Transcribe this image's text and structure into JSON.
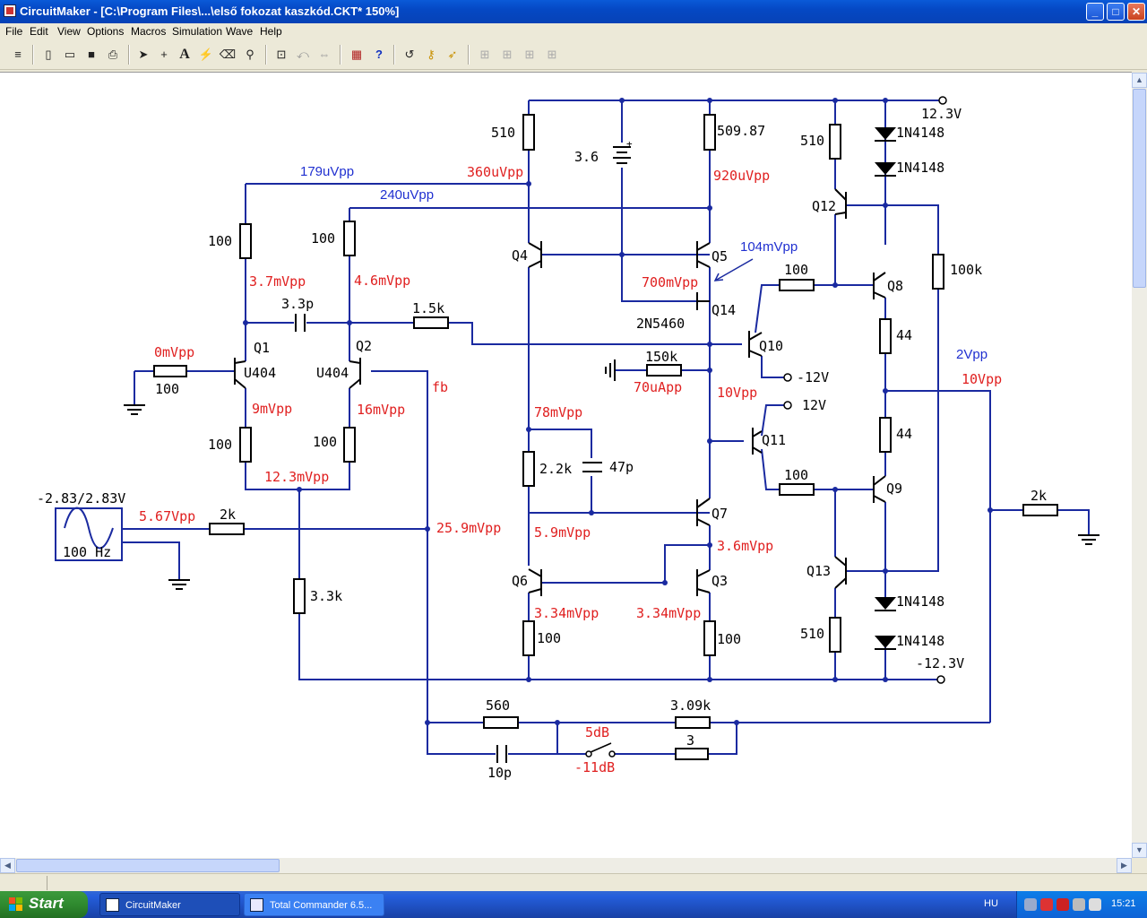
{
  "window": {
    "title": "CircuitMaker - [C:\\Program Files\\...\\első fokozat kaszkód.CKT* 150%]"
  },
  "window_buttons": {
    "minimize": "_",
    "maximize": "□",
    "close": "✕"
  },
  "menu": [
    "File",
    "Edit",
    "View",
    "Options",
    "Macros",
    "Simulation",
    "Wave",
    "Help"
  ],
  "toolbar": {
    "icons": [
      "options-icon",
      "new-icon",
      "open-icon",
      "save-icon",
      "print-icon",
      "arrow-tool-icon",
      "wire-tool-icon",
      "text-tool-icon",
      "probe-tool-icon",
      "delete-tool-icon",
      "zoom-tool-icon",
      "zoom-fit-icon",
      "rotate-icon",
      "mirror-icon",
      "netlist-icon",
      "help-icon",
      "reset-icon",
      "step-icon",
      "run-icon",
      "grid1-icon",
      "grid2-icon",
      "grid3-icon",
      "grid4-icon"
    ],
    "glyphs": {
      "arrow": "➤",
      "wire": "+",
      "text": "A",
      "probe": "⚡",
      "zoom": "🔍",
      "help": "?"
    }
  },
  "schematic": {
    "labels_black": {
      "r510a": "510",
      "c36": "3.6",
      "r50987": "509.87",
      "r510b": "510",
      "d1": "1N4148",
      "d2": "1N4148",
      "v123": "12.3V",
      "q12": "Q12",
      "r100k": "100k",
      "q8": "Q8",
      "r100a": "100",
      "r100b": "100",
      "r100c": "100",
      "q4": "Q4",
      "q5": "Q5",
      "c33p": "3.3p",
      "r15k": "1.5k",
      "q14": "Q14",
      "q14type": "2N5460",
      "q10": "Q10",
      "r44a": "44",
      "q1": "Q1",
      "q2": "Q2",
      "u404a": "U404",
      "u404b": "U404",
      "r100d": "100",
      "r150k": "150k",
      "vm12": "-12V",
      "r22k": "2.2k",
      "c47p": "47p",
      "v12": "12V",
      "q11": "Q11",
      "r44b": "44",
      "r100e": "100",
      "r100f": "100",
      "q9": "Q9",
      "src_range": "-2.83/2.83V",
      "src_freq": "100 Hz",
      "r2k": "2k",
      "r2k_out": "2k",
      "q7": "Q7",
      "r33k": "3.3k",
      "q6": "Q6",
      "q3": "Q3",
      "q13": "Q13",
      "d3": "1N4148",
      "d4": "1N4148",
      "r100g": "100",
      "r100h": "100",
      "r510c": "510",
      "vm123": "-12.3V",
      "r560": "560",
      "r309k": "3.09k",
      "r3": "3",
      "c10p": "10p"
    },
    "labels_blue": {
      "p179": "179uVpp",
      "p240": "240uVpp",
      "p104": "104mVpp",
      "p2": "2Vpp"
    },
    "labels_red": {
      "p360": "360uVpp",
      "p920": "920uVpp",
      "p37": "3.7mVpp",
      "p46": "4.6mVpp",
      "p700": "700mVpp",
      "p0": "0mVpp",
      "p9": "9mVpp",
      "p16": "16mVpp",
      "fb": "fb",
      "p70": "70uApp",
      "p10v": "10Vpp",
      "p10v_b": "10Vpp",
      "p123": "12.3mVpp",
      "p78": "78mVpp",
      "p567": "5.67Vpp",
      "p259": "25.9mVpp",
      "p59": "5.9mVpp",
      "p36": "3.6mVpp",
      "p334a": "3.34mVpp",
      "p334b": "3.34mVpp",
      "g5": "5dB",
      "g11": "-11dB"
    },
    "colors": {
      "wire": "#1a2aa0",
      "component": "#000000",
      "red_label": "#e02020",
      "blue_label": "#2030d0"
    }
  },
  "taskbar": {
    "start": "Start",
    "tasks": [
      "CircuitMaker",
      "Total Commander 6.5..."
    ],
    "lang": "HU",
    "clock": "15:21"
  }
}
